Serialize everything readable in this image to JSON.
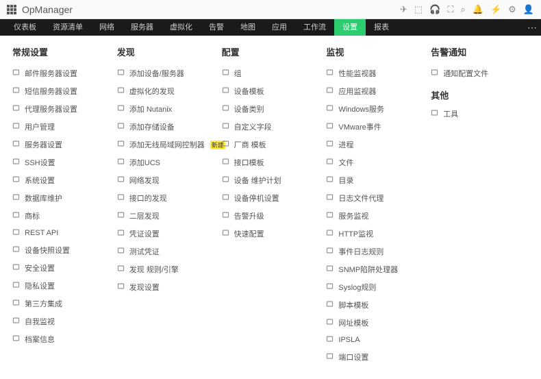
{
  "brand": "OpManager",
  "nav": {
    "tabs": [
      "仪表板",
      "资源清单",
      "网络",
      "服务器",
      "虚拟化",
      "告警",
      "地图",
      "应用",
      "工作流",
      "设置",
      "报表"
    ],
    "activeIndex": 9
  },
  "columns": [
    {
      "title": "常规设置",
      "items": [
        {
          "icon": "mail",
          "label": "邮件服务器设置"
        },
        {
          "icon": "sms",
          "label": "短信服务器设置"
        },
        {
          "icon": "proxy",
          "label": "代理服务器设置"
        },
        {
          "icon": "user",
          "label": "用户管理"
        },
        {
          "icon": "server",
          "label": "服务器设置"
        },
        {
          "icon": "ssh",
          "label": "SSH设置"
        },
        {
          "icon": "system",
          "label": "系统设置"
        },
        {
          "icon": "db",
          "label": "数据库维护"
        },
        {
          "icon": "tag",
          "label": "商标"
        },
        {
          "icon": "api",
          "label": "REST API"
        },
        {
          "icon": "snap",
          "label": "设备快照设置"
        },
        {
          "icon": "security",
          "label": "安全设置"
        },
        {
          "icon": "privacy",
          "label": "隐私设置"
        },
        {
          "icon": "plug",
          "label": "第三方集成"
        },
        {
          "icon": "self",
          "label": "自我监视"
        },
        {
          "icon": "files",
          "label": "档案信息"
        }
      ]
    },
    {
      "title": "发现",
      "items": [
        {
          "icon": "add",
          "label": "添加设备/服务器"
        },
        {
          "icon": "virt",
          "label": "虚拟化的发现"
        },
        {
          "icon": "x",
          "label": "添加 Nutanix"
        },
        {
          "icon": "storage",
          "label": "添加存储设备"
        },
        {
          "icon": "wlan",
          "label": "添加无线局域网控制器",
          "badge": "新建"
        },
        {
          "icon": "ucs",
          "label": "添加UCS"
        },
        {
          "icon": "net",
          "label": "网络发现"
        },
        {
          "icon": "iface",
          "label": "接口的发现"
        },
        {
          "icon": "l2",
          "label": "二层发现"
        },
        {
          "icon": "cred",
          "label": "凭证设置"
        },
        {
          "icon": "test",
          "label": "测试凭证"
        },
        {
          "icon": "rule",
          "label": "发现 规则/引擎"
        },
        {
          "icon": "disc",
          "label": "发现设置"
        }
      ]
    },
    {
      "title": "配置",
      "items": [
        {
          "icon": "group",
          "label": "组"
        },
        {
          "icon": "tpl",
          "label": "设备模板"
        },
        {
          "icon": "type",
          "label": "设备类别"
        },
        {
          "icon": "field",
          "label": "自定义字段"
        },
        {
          "icon": "vendor",
          "label": "厂商 模板"
        },
        {
          "icon": "itpl",
          "label": "接口模板"
        },
        {
          "icon": "maint",
          "label": "设备 维护计划"
        },
        {
          "icon": "down",
          "label": "设备停机设置"
        },
        {
          "icon": "upgrade",
          "label": "告警升级"
        },
        {
          "icon": "quick",
          "label": "快速配置"
        }
      ]
    },
    {
      "title": "监视",
      "items": [
        {
          "icon": "perf",
          "label": "性能监视器"
        },
        {
          "icon": "app",
          "label": "应用监视器"
        },
        {
          "icon": "win",
          "label": "Windows服务"
        },
        {
          "icon": "vm",
          "label": "VMware事件"
        },
        {
          "icon": "proc",
          "label": "进程"
        },
        {
          "icon": "file",
          "label": "文件"
        },
        {
          "icon": "dir",
          "label": "目录"
        },
        {
          "icon": "logproxy",
          "label": "日志文件代理"
        },
        {
          "icon": "svc",
          "label": "服务监视"
        },
        {
          "icon": "http",
          "label": "HTTP监视"
        },
        {
          "icon": "evlog",
          "label": "事件日志规则"
        },
        {
          "icon": "snmp",
          "label": "SNMP陷阱处理器"
        },
        {
          "icon": "syslog",
          "label": "Syslog规则"
        },
        {
          "icon": "script",
          "label": "脚本模板"
        },
        {
          "icon": "url",
          "label": "网址模板"
        },
        {
          "icon": "ipsla",
          "label": "IPSLA"
        },
        {
          "icon": "port",
          "label": "端口设置"
        }
      ]
    },
    {
      "title": "告警通知",
      "items": [
        {
          "icon": "notif",
          "label": "通知配置文件"
        }
      ],
      "subTitle": "其他",
      "subItems": [
        {
          "icon": "tool",
          "label": "工具"
        }
      ]
    }
  ]
}
